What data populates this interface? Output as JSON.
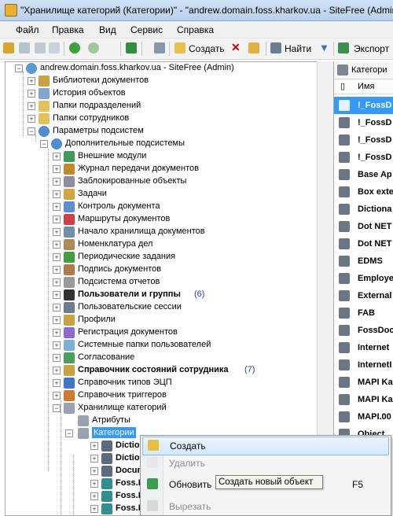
{
  "window": {
    "title": "\"Хранилище категорий (Категории)\" - \"andrew.domain.foss.kharkov.ua - SiteFree (Admin)"
  },
  "menu": {
    "items": [
      "Файл",
      "Правка",
      "Вид",
      "Сервис",
      "Справка"
    ]
  },
  "toolbar": {
    "create": "Создать",
    "find": "Найти",
    "export": "Экспорт"
  },
  "tree": {
    "root": "andrew.domain.foss.kharkov.ua - SiteFree (Admin)",
    "level1": [
      "Библиотеки документов",
      "История объектов",
      "Папки подразделений",
      "Папки сотрудников",
      "Параметры подсистем"
    ],
    "additional": "Дополнительные подсистемы",
    "level3": [
      {
        "label": "Внешние модули"
      },
      {
        "label": "Журнал передачи документов"
      },
      {
        "label": "Заблокированные объекты"
      },
      {
        "label": "Задачи"
      },
      {
        "label": "Контроль документа"
      },
      {
        "label": "Маршруты документов"
      },
      {
        "label": "Начало хранилища документов"
      },
      {
        "label": "Номенклатура дел"
      },
      {
        "label": "Периодические задания"
      },
      {
        "label": "Подпись документов"
      },
      {
        "label": "Подсистема отчетов"
      },
      {
        "label": "Пользователи и группы",
        "count": "(6)"
      },
      {
        "label": "Пользовательские сессии"
      },
      {
        "label": "Профили"
      },
      {
        "label": "Регистрация документов"
      },
      {
        "label": "Системные папки пользователей"
      },
      {
        "label": "Согласование"
      },
      {
        "label": "Справочник состояний сотрудника",
        "count": "(7)"
      },
      {
        "label": "Справочник типов ЭЦП"
      },
      {
        "label": "Справочник триггеров"
      },
      {
        "label": "Хранилище категорий"
      }
    ],
    "attributes": "Атрибуты",
    "categories": "Категории",
    "categories_children": [
      "Dictio",
      "Dictio",
      "Docum",
      "Foss.D",
      "Foss.D",
      "Foss.D"
    ]
  },
  "right_pane": {
    "header": "Категори",
    "column_name": "Имя",
    "items": [
      "!_FossD",
      "!_FossD",
      "!_FossD",
      "!_FossD",
      "Base Ap",
      "Box exte",
      "Dictiona",
      "Dot NET",
      "Dot NET",
      "EDMS",
      "Employe",
      "External",
      "FAB",
      "FossDoc",
      "Internet",
      "InternetI",
      "MAPI Ka",
      "MAPI Ka",
      "MAPI.00",
      "Object"
    ]
  },
  "context_menu": {
    "create": "Создать",
    "delete": "Удалить",
    "refresh": "Обновить",
    "refresh_key": "F5",
    "cut": "Вырезать"
  },
  "tooltip": "Создать новый объект"
}
